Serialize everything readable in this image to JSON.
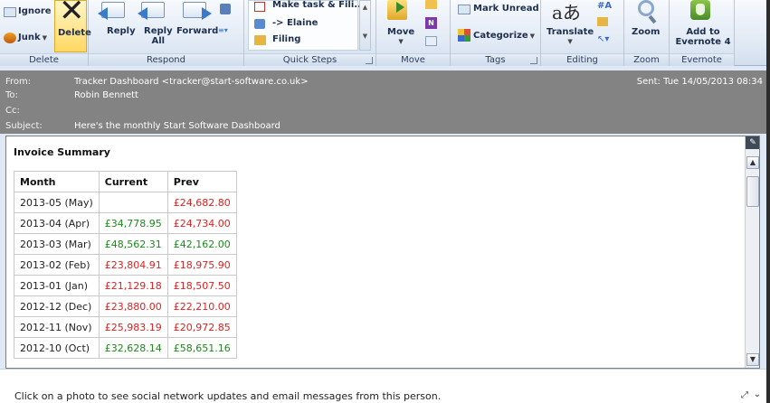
{
  "ribbon": {
    "delete_group": {
      "label": "Delete",
      "ignore": "Ignore",
      "junk": "Junk",
      "delete": "Delete"
    },
    "respond_group": {
      "label": "Respond",
      "reply": "Reply",
      "reply_all_1": "Reply",
      "reply_all_2": "All",
      "forward": "Forward"
    },
    "quick_steps": {
      "label": "Quick Steps",
      "items": [
        "Make task & Fili...",
        "-> Elaine",
        "Filing"
      ]
    },
    "move_group": {
      "label": "Move",
      "move": "Move"
    },
    "tags_group": {
      "label": "Tags",
      "mark_unread": "Mark Unread",
      "categorize": "Categorize"
    },
    "editing_group": {
      "label": "Editing",
      "translate": "Translate",
      "glyph": "aあ"
    },
    "zoom_group": {
      "label": "Zoom",
      "zoom": "Zoom"
    },
    "evernote_group": {
      "label": "Evernote",
      "add_1": "Add to",
      "add_2": "Evernote 4"
    }
  },
  "header": {
    "from_label": "From:",
    "from_value": "Tracker Dashboard <tracker@start-software.co.uk>",
    "to_label": "To:",
    "to_value": "Robin Bennett",
    "cc_label": "Cc:",
    "cc_value": "",
    "subject_label": "Subject:",
    "subject_value": "Here's the monthly Start Software Dashboard",
    "sent": "Sent:  Tue 14/05/2013 08:34"
  },
  "invoice": {
    "title": "Invoice Summary",
    "columns": [
      "Month",
      "Current",
      "Prev"
    ],
    "rows": [
      {
        "month": "2013-05 (May)",
        "current": "",
        "current_color": "#1a8a1a",
        "prev": "£24,682.80",
        "prev_color": "#e02020"
      },
      {
        "month": "2013-04 (Apr)",
        "current": "£34,778.95",
        "current_color": "#1a8a1a",
        "prev": "£24,734.00",
        "prev_color": "#e02020"
      },
      {
        "month": "2013-03 (Mar)",
        "current": "£48,562.31",
        "current_color": "#1a8a1a",
        "prev": "£42,162.00",
        "prev_color": "#1a8a1a"
      },
      {
        "month": "2013-02 (Feb)",
        "current": "£23,804.91",
        "current_color": "#e02020",
        "prev": "£18,975.90",
        "prev_color": "#e02020"
      },
      {
        "month": "2013-01 (Jan)",
        "current": "£21,129.18",
        "current_color": "#e02020",
        "prev": "£18,507.50",
        "prev_color": "#e02020"
      },
      {
        "month": "2012-12 (Dec)",
        "current": "£23,880.00",
        "current_color": "#e02020",
        "prev": "£22,210.00",
        "prev_color": "#e02020"
      },
      {
        "month": "2012-11 (Nov)",
        "current": "£25,983.19",
        "current_color": "#e02020",
        "prev": "£20,972.85",
        "prev_color": "#e02020"
      },
      {
        "month": "2012-10 (Oct)",
        "current": "£32,628.14",
        "current_color": "#1a8a1a",
        "prev": "£58,651.16",
        "prev_color": "#1a8a1a"
      }
    ]
  },
  "social": {
    "text": "Click on a photo to see social network updates and email messages from this person."
  },
  "colors": {
    "positive": "#1a8a1a",
    "negative": "#e02020",
    "header_bg": "#838383",
    "accent": "#3b79c9"
  }
}
